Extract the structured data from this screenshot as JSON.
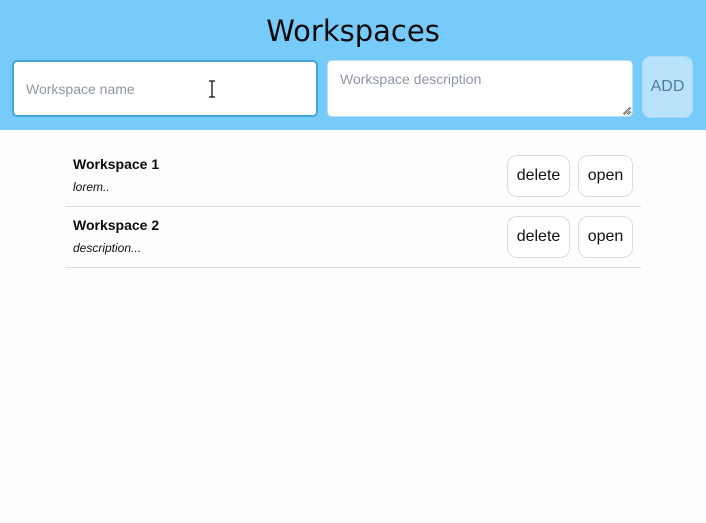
{
  "header": {
    "title": "Workspaces",
    "background_color": "#76cbfa"
  },
  "form": {
    "name_placeholder": "Workspace name",
    "name_value": "",
    "description_placeholder": "Workspace description",
    "description_value": "",
    "add_label": "ADD"
  },
  "workspaces": [
    {
      "name": "Workspace 1",
      "description": "lorem..",
      "delete_label": "delete",
      "open_label": "open"
    },
    {
      "name": "Workspace 2",
      "description": "description...",
      "delete_label": "delete",
      "open_label": "open"
    }
  ]
}
